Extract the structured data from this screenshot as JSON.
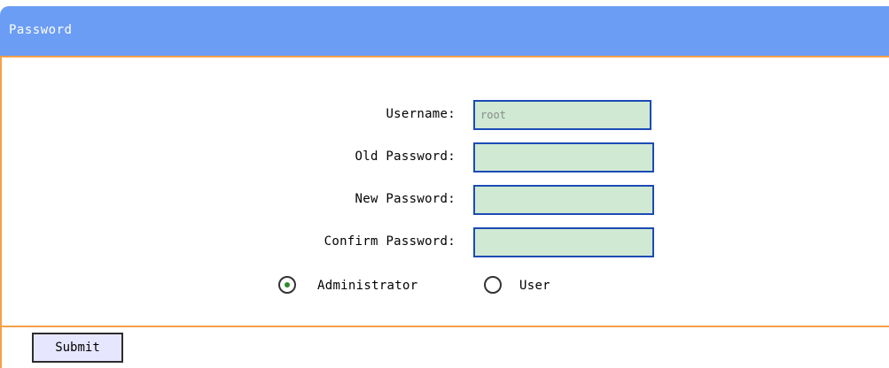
{
  "header": {
    "title": "Password"
  },
  "form": {
    "username_label": "Username:",
    "username_value": "root",
    "old_password_label": "Old Password:",
    "new_password_label": "New Password:",
    "confirm_password_label": "Confirm Password:",
    "role_options": [
      {
        "label": "Administrator",
        "selected": true
      },
      {
        "label": "User",
        "selected": false
      }
    ],
    "submit_label": "Submit"
  },
  "colors": {
    "header_bg": "#6b9df5",
    "accent_border": "#f5a04a",
    "input_bg": "#cfe9d3",
    "input_border": "#1c4bb5"
  }
}
